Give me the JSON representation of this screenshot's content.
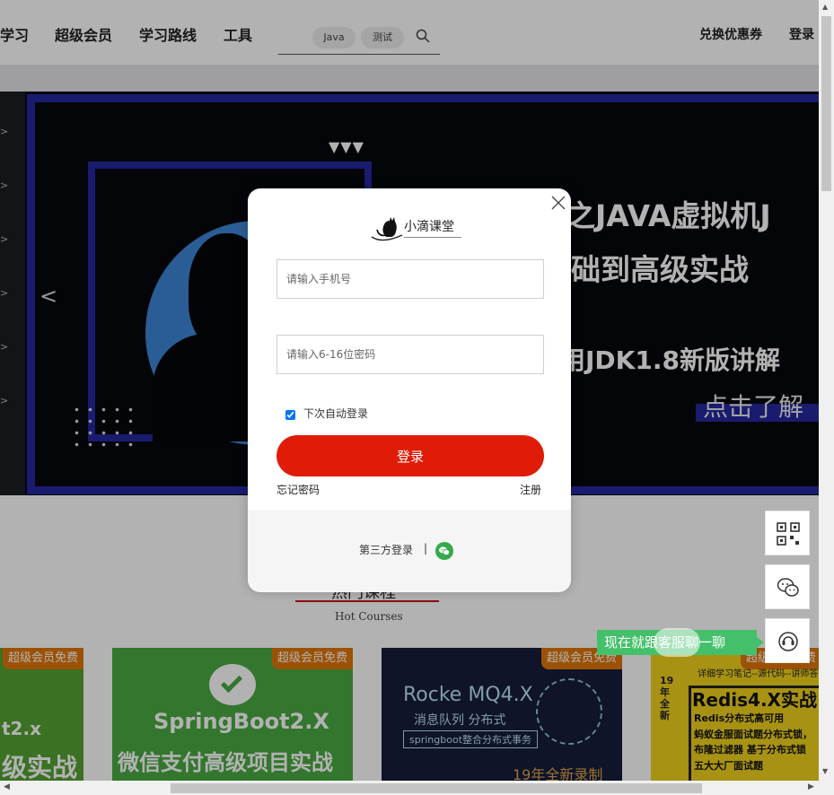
{
  "nav": {
    "items": [
      "学习",
      "超级会员",
      "学习路线",
      "工具"
    ],
    "search_tags": [
      "Java",
      "测试"
    ],
    "search_icon": "search-icon",
    "coupon": "兑换优惠券",
    "login": "登录"
  },
  "banner": {
    "line1": "之JAVA虚拟机J",
    "line2": "础到高级实战",
    "line3": "用JDK1.8新版讲解",
    "cta": "点击了解",
    "prev": "<",
    "triangles": "▼▼▼"
  },
  "hot": {
    "title": "热门课程",
    "subtitle": "Hot Courses"
  },
  "cards": [
    {
      "badge": "超级会员免费",
      "line1": "t2.x",
      "line2": "级实战"
    },
    {
      "badge": "超级会员免费",
      "line1": "SpringBoot2.X",
      "line2": "微信支付高级项目实战"
    },
    {
      "badge": "超级会员免费",
      "line1": "Rocke MQ4.X",
      "line2": "消息队列 分布式",
      "line3": "springboot整合分布式事务",
      "line4": "19年全新录制"
    },
    {
      "badge": "超级会员免费",
      "small": "详细学习笔记--源代码--讲师答",
      "side": "19年全新",
      "title": "Redis4.X实战",
      "lines": [
        "Redis分布式高可用",
        "蚂蚁金服面试题分布式锁，",
        "布隆过滤器 基于分布式锁",
        "五大大厂面试题"
      ]
    }
  ],
  "side_widgets": {
    "chat_tip": "现在就跟客服聊一聊",
    "icons": [
      "qr-code-icon",
      "wechat-icon",
      "customer-service-icon"
    ]
  },
  "modal": {
    "logo_text": "小滴课堂",
    "phone_placeholder": "请输入手机号",
    "password_placeholder": "请输入6-16位密码",
    "remember_label": "下次自动登录",
    "remember_checked": true,
    "login_button": "登录",
    "forgot": "忘记密码",
    "register": "注册",
    "third_party": "第三方登录",
    "separator": "|",
    "third_party_icon": "wechat-icon"
  },
  "colors": {
    "accent_red": "#e01c08",
    "banner_blue": "#2427a0",
    "wechat_green": "#36a94b",
    "badge_orange": "#e0760a"
  }
}
